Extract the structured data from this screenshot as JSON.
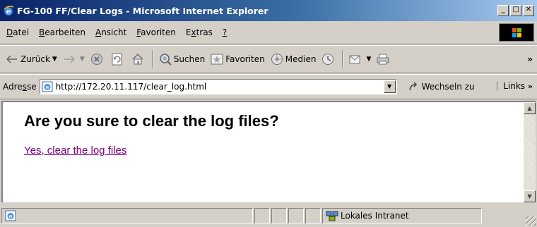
{
  "window": {
    "title": "FG-100 FF/Clear Logs - Microsoft Internet Explorer",
    "caption_buttons": {
      "minimize": "_",
      "maximize": "□",
      "close": "✕"
    }
  },
  "menu": {
    "items": [
      {
        "accel": "D",
        "rest": "atei"
      },
      {
        "accel": "B",
        "rest": "earbeiten"
      },
      {
        "accel": "A",
        "rest": "nsicht"
      },
      {
        "accel": "F",
        "rest": "avoriten"
      },
      {
        "pre": "E",
        "accel": "x",
        "rest": "tras"
      },
      {
        "accel": "?",
        "rest": ""
      }
    ]
  },
  "toolbar": {
    "back_label": "Zurück",
    "search_label": "Suchen",
    "favorites_label": "Favoriten",
    "media_label": "Medien",
    "more": "»"
  },
  "address": {
    "label_pre": "Adre",
    "label_accel": "s",
    "label_post": "se",
    "url": "http://172.20.11.117/clear_log.html",
    "go_label": "Wechseln zu",
    "links_label": "Links",
    "links_more": "»"
  },
  "page": {
    "heading": "Are you sure to clear the log files?",
    "link_text": "Yes, clear the log files"
  },
  "status": {
    "zone": "Lokales Intranet"
  },
  "colors": {
    "visited_link": "#800080",
    "titlebar_start": "#0a246a",
    "titlebar_end": "#a6caf0"
  },
  "icons": [
    "ie-icon",
    "back-arrow-icon",
    "forward-arrow-icon",
    "stop-icon",
    "refresh-icon",
    "home-icon",
    "search-icon",
    "favorites-icon",
    "media-icon",
    "history-icon",
    "mail-icon",
    "print-icon",
    "page-icon",
    "go-arrow-icon",
    "intranet-icon",
    "windows-logo-icon"
  ]
}
